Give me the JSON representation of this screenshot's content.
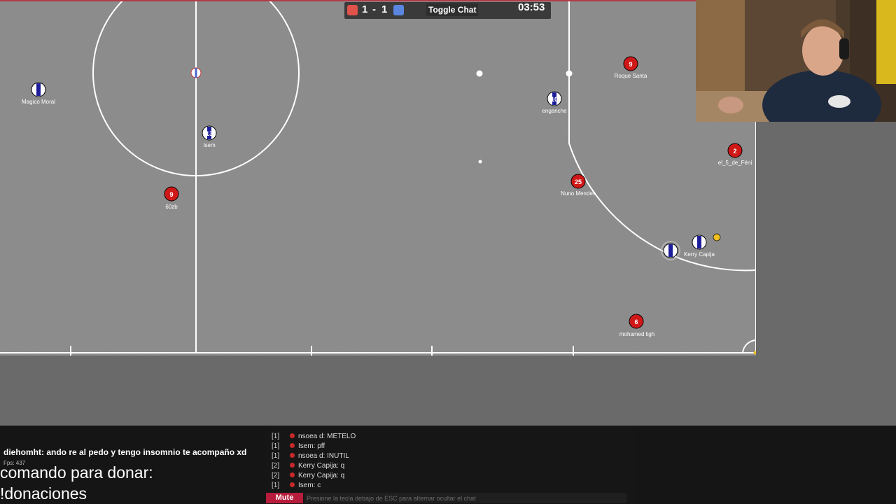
{
  "scoreboard": {
    "red_score": "1",
    "separator": "-",
    "blue_score": "1",
    "toggle_chat_label": "Toggle Chat",
    "timer": "03:53",
    "red_color": "#e0524a",
    "blue_color": "#5a86e0"
  },
  "players": [
    {
      "name": "Magico Moral",
      "team": "blue",
      "number": ""
    },
    {
      "name": "Isem",
      "team": "blue",
      "number": "13"
    },
    {
      "name": "60zb",
      "team": "red",
      "number": "9"
    },
    {
      "name": "enganche",
      "team": "blue",
      "number": "10"
    },
    {
      "name": "Roque Santa",
      "team": "red",
      "number": "9"
    },
    {
      "name": "el_5_de_Féni",
      "team": "red",
      "number": "2"
    },
    {
      "name": "Nuno Mendes",
      "team": "red",
      "number": "25"
    },
    {
      "name": "Kerry Capija",
      "team": "blue",
      "number": ""
    },
    {
      "name": "mohamed ligh",
      "team": "red",
      "number": "6"
    }
  ],
  "game_chat": {
    "messages": [
      {
        "team": "[1]",
        "text": "nsoea d: METELO"
      },
      {
        "team": "[1]",
        "text": "Isem: pff"
      },
      {
        "team": "[1]",
        "text": "nsoea d: INUTIL"
      },
      {
        "team": "[2]",
        "text": "Kerry Capija: q"
      },
      {
        "team": "[2]",
        "text": "Kerry Capija: q"
      },
      {
        "team": "[1]",
        "text": "Isem: c"
      }
    ],
    "mute_label": "Mute",
    "input_placeholder": "Presione la tecla debajo de ESC para alternar ocultar el chat"
  },
  "stream_overlay": {
    "chat_message": "diehomht: ando re al pedo y tengo insomnio te acompaño xd",
    "fps": "Fps: 437",
    "donate_line1": "comando para donar:",
    "donate_line2": "!donaciones"
  },
  "colors": {
    "field": "#8a8a8a",
    "red_team": "#d01818",
    "blue_team": "#ffffff",
    "ball": "#f0c020"
  }
}
